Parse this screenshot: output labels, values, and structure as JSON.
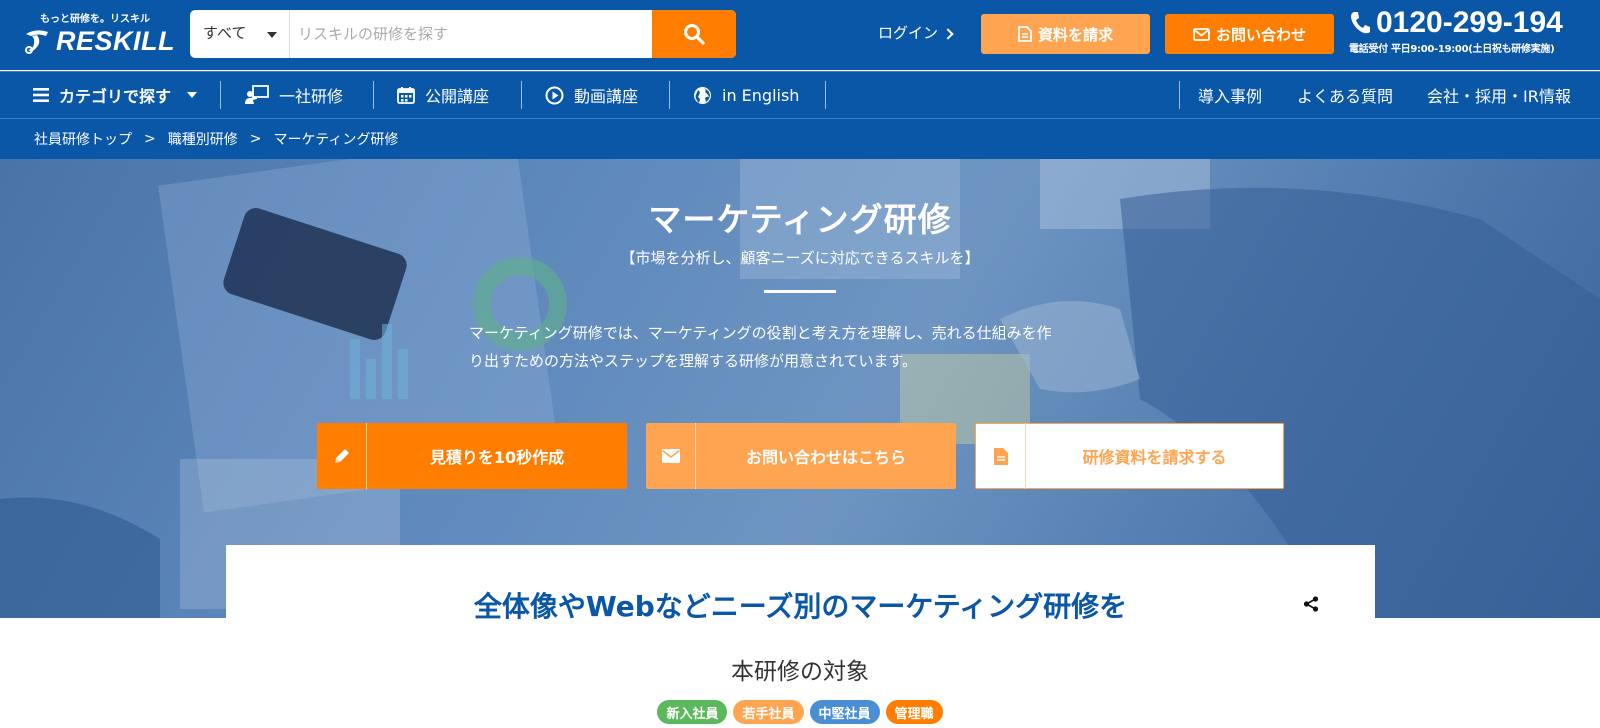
{
  "header": {
    "logo_tagline": "もっと研修を。リスキル",
    "logo_word": "RESKILL",
    "search": {
      "scope": "すべて",
      "placeholder": "リスキルの研修を探す",
      "value": ""
    },
    "login_label": "ログイン",
    "request_docs_label": "資料を請求",
    "contact_label": "お問い合わせ",
    "phone_number": "0120-299-194",
    "phone_hours": "電話受付 平日9:00-19:00(土日祝も研修実施)",
    "colors": {
      "brand_blue": "#0a57a8",
      "accent_orange": "#ff7d00",
      "accent_light_orange": "#ffa552"
    }
  },
  "nav": {
    "category_label": "カテゴリで探す",
    "items": [
      {
        "label": "一社研修",
        "icon": "presenter-icon"
      },
      {
        "label": "公開講座",
        "icon": "calendar-icon"
      },
      {
        "label": "動画講座",
        "icon": "play-circle-icon"
      },
      {
        "label": "in English",
        "icon": "globe-icon"
      }
    ],
    "right_items": [
      {
        "label": "導入事例"
      },
      {
        "label": "よくある質問"
      },
      {
        "label": "会社・採用・IR情報"
      }
    ]
  },
  "breadcrumb": {
    "items": [
      "社員研修トップ",
      "職種別研修",
      "マーケティング研修"
    ],
    "separator": ">"
  },
  "hero": {
    "title": "マーケティング研修",
    "subtitle": "【市場を分析し、顧客ニーズに対応できるスキルを】",
    "description_line1": "マーケティング研修では、マーケティングの役割と考え方を理解し、売れる仕組みを作",
    "description_line2": "り出すための方法やステップを理解する研修が用意されています。",
    "cta": {
      "quote_label": "見積りを10秒作成",
      "contact_label": "お問い合わせはこちら",
      "docs_label": "研修資料を請求する"
    }
  },
  "content": {
    "panel_title": "全体像やWebなどニーズ別のマーケティング研修を",
    "target_title": "本研修の対象",
    "tags": [
      {
        "label": "新入社員",
        "color": "#5cb85c"
      },
      {
        "label": "若手社員",
        "color": "#ffa552"
      },
      {
        "label": "中堅社員",
        "color": "#4a8fd4"
      },
      {
        "label": "管理職",
        "color": "#ff7d00"
      }
    ]
  }
}
